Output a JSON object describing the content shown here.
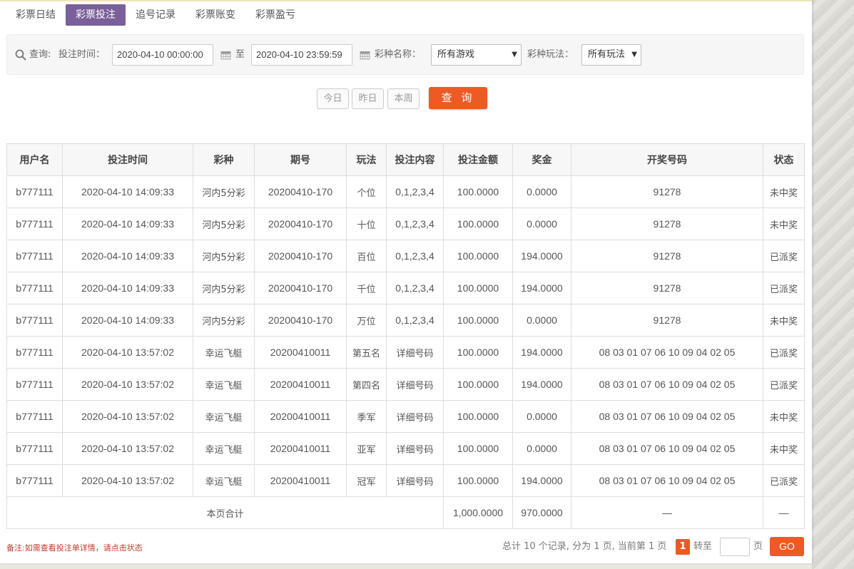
{
  "tabs": [
    {
      "label": "彩票日结"
    },
    {
      "label": "彩票投注"
    },
    {
      "label": "追号记录"
    },
    {
      "label": "彩票账变"
    },
    {
      "label": "彩票盈亏"
    }
  ],
  "filter": {
    "query_label": "查询:",
    "bet_time_label": "投注时间：",
    "start_time": "2020-04-10 00:00:00",
    "to_label": "至",
    "end_time": "2020-04-10 23:59:59",
    "game_label": "彩种名称：",
    "game_value": "所有游戏",
    "play_label": "彩种玩法：",
    "play_value": "所有玩法"
  },
  "quick": {
    "today": "今日",
    "yesterday": "昨日",
    "week": "本周",
    "query": "查 询"
  },
  "colors": {
    "accent": "#ee5a24",
    "tab_active": "#7a5f9a",
    "won": "#e06a1c",
    "green": "#1f8a1f"
  },
  "table": {
    "headers": [
      "用户名",
      "投注时间",
      "彩种",
      "期号",
      "玩法",
      "投注内容",
      "投注金额",
      "奖金",
      "开奖号码",
      "状态"
    ],
    "rows": [
      {
        "user": "b777111",
        "time": "2020-04-10 14:09:33",
        "game": "河内5分彩",
        "issue": "20200410-170",
        "play": "个位",
        "content": "0,1,2,3,4",
        "amount": "100.0000",
        "bonus": "0.0000",
        "numbers": "91278",
        "status": "未中奖",
        "won": false,
        "link": false
      },
      {
        "user": "b777111",
        "time": "2020-04-10 14:09:33",
        "game": "河内5分彩",
        "issue": "20200410-170",
        "play": "十位",
        "content": "0,1,2,3,4",
        "amount": "100.0000",
        "bonus": "0.0000",
        "numbers": "91278",
        "status": "未中奖",
        "won": false,
        "link": false
      },
      {
        "user": "b777111",
        "time": "2020-04-10 14:09:33",
        "game": "河内5分彩",
        "issue": "20200410-170",
        "play": "百位",
        "content": "0,1,2,3,4",
        "amount": "100.0000",
        "bonus": "194.0000",
        "numbers": "91278",
        "status": "已派奖",
        "won": true,
        "link": false
      },
      {
        "user": "b777111",
        "time": "2020-04-10 14:09:33",
        "game": "河内5分彩",
        "issue": "20200410-170",
        "play": "千位",
        "content": "0,1,2,3,4",
        "amount": "100.0000",
        "bonus": "194.0000",
        "numbers": "91278",
        "status": "已派奖",
        "won": true,
        "link": false
      },
      {
        "user": "b777111",
        "time": "2020-04-10 14:09:33",
        "game": "河内5分彩",
        "issue": "20200410-170",
        "play": "万位",
        "content": "0,1,2,3,4",
        "amount": "100.0000",
        "bonus": "0.0000",
        "numbers": "91278",
        "status": "未中奖",
        "won": false,
        "link": false
      },
      {
        "user": "b777111",
        "time": "2020-04-10 13:57:02",
        "game": "幸运飞艇",
        "issue": "20200410011",
        "play": "第五名",
        "content": "详细号码",
        "amount": "100.0000",
        "bonus": "194.0000",
        "numbers": "08 03 01 07 06 10 09 04 02 05",
        "status": "已派奖",
        "won": true,
        "link": true
      },
      {
        "user": "b777111",
        "time": "2020-04-10 13:57:02",
        "game": "幸运飞艇",
        "issue": "20200410011",
        "play": "第四名",
        "content": "详细号码",
        "amount": "100.0000",
        "bonus": "194.0000",
        "numbers": "08 03 01 07 06 10 09 04 02 05",
        "status": "已派奖",
        "won": true,
        "link": true
      },
      {
        "user": "b777111",
        "time": "2020-04-10 13:57:02",
        "game": "幸运飞艇",
        "issue": "20200410011",
        "play": "季军",
        "content": "详细号码",
        "amount": "100.0000",
        "bonus": "0.0000",
        "numbers": "08 03 01 07 06 10 09 04 02 05",
        "status": "未中奖",
        "won": false,
        "link": true
      },
      {
        "user": "b777111",
        "time": "2020-04-10 13:57:02",
        "game": "幸运飞艇",
        "issue": "20200410011",
        "play": "亚军",
        "content": "详细号码",
        "amount": "100.0000",
        "bonus": "0.0000",
        "numbers": "08 03 01 07 06 10 09 04 02 05",
        "status": "未中奖",
        "won": false,
        "link": true
      },
      {
        "user": "b777111",
        "time": "2020-04-10 13:57:02",
        "game": "幸运飞艇",
        "issue": "20200410011",
        "play": "冠军",
        "content": "详细号码",
        "amount": "100.0000",
        "bonus": "194.0000",
        "numbers": "08 03 01 07 06 10 09 04 02 05",
        "status": "已派奖",
        "won": true,
        "link": true
      }
    ],
    "summary": {
      "label": "本页合计",
      "amount": "1,000.0000",
      "bonus": "970.0000",
      "numbers": "—",
      "status": "—"
    }
  },
  "footer": {
    "note": "备注:如需查看投注单详情，请点击状态",
    "pager_text": "总计 10 个记录, 分为 1 页, 当前第 1 页",
    "current_page": "1",
    "goto_label": "转至",
    "page_unit": "页",
    "go": "GO"
  }
}
